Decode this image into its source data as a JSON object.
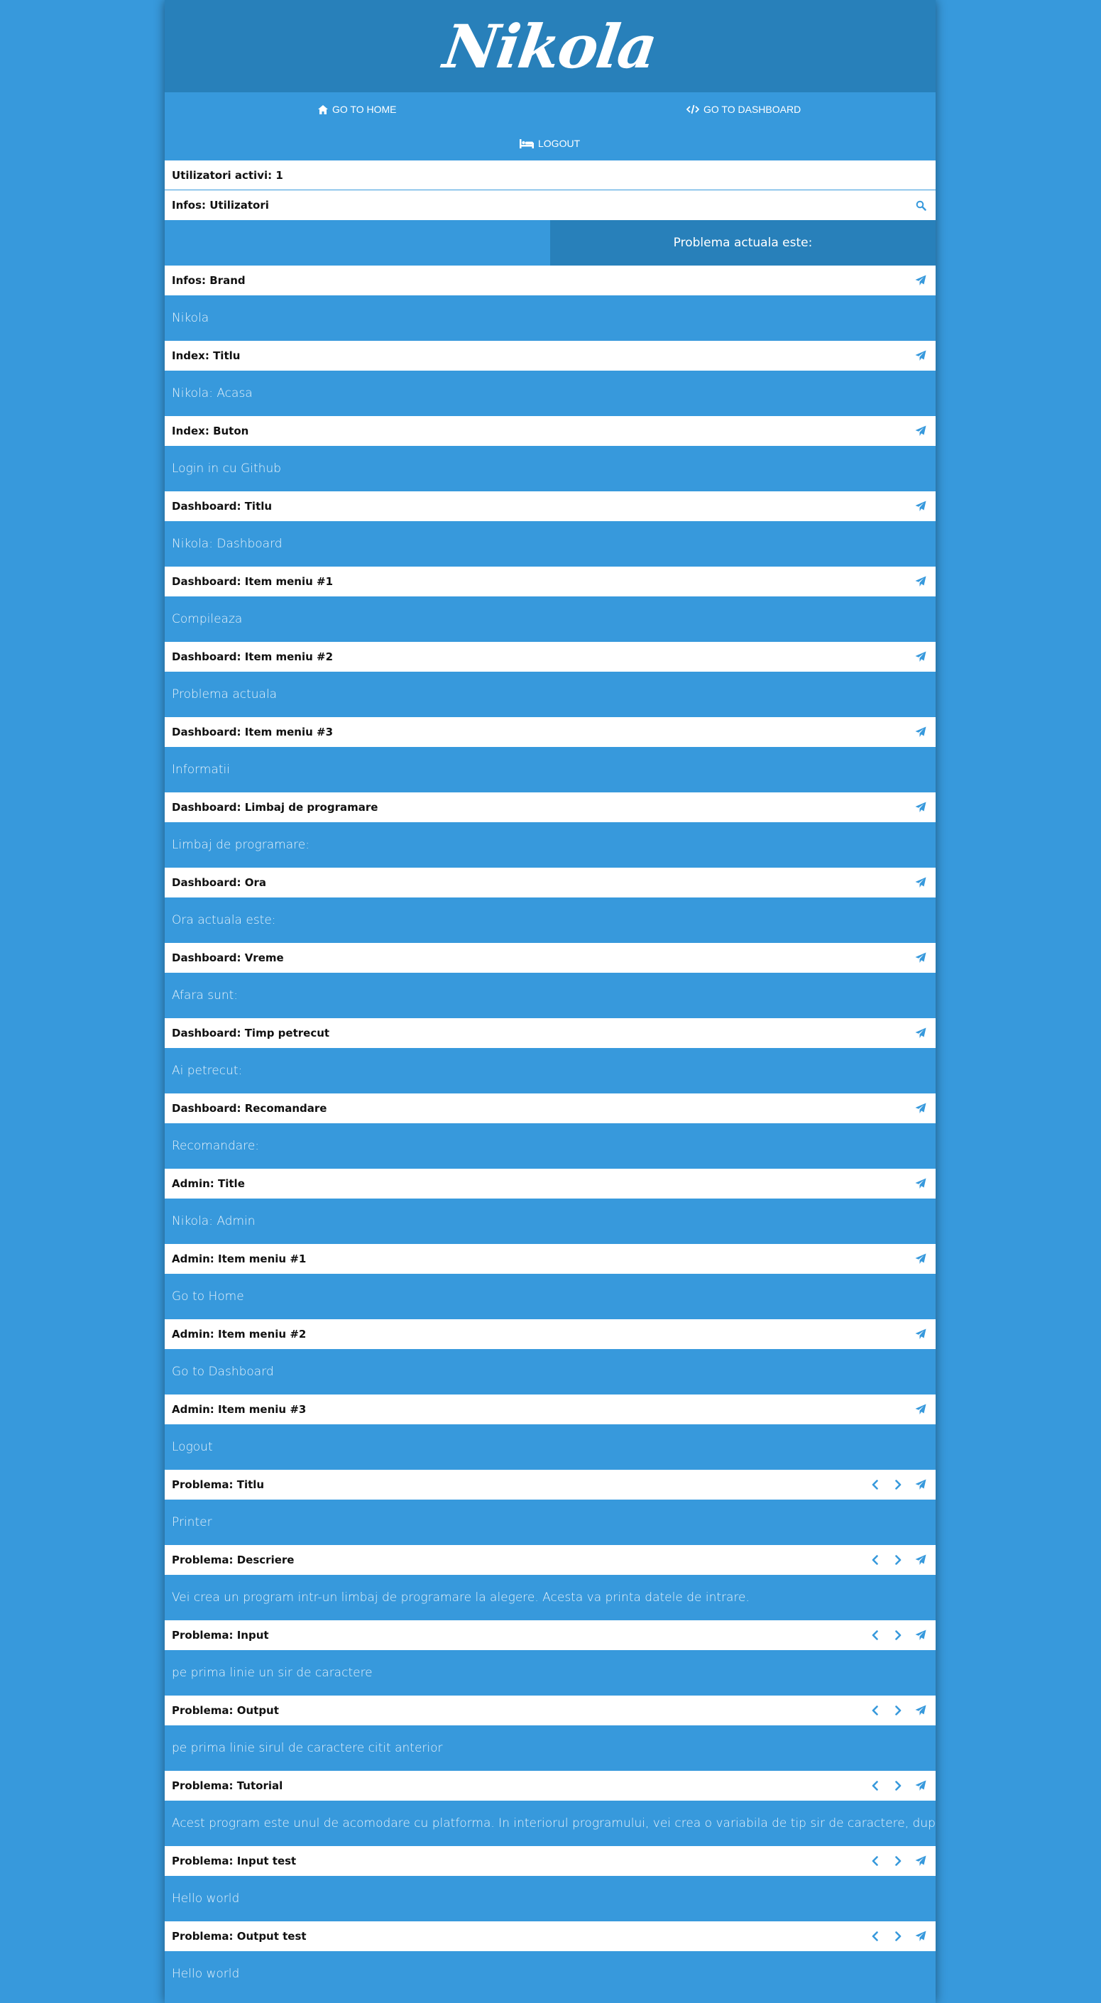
{
  "brand": "Nikola",
  "nav": {
    "home": "GO TO HOME",
    "dashboard": "GO TO DASHBOARD",
    "logout": "LOGOUT"
  },
  "active_users": "Utilizatori activi: 1",
  "users_section": "Infos: Utilizatori",
  "problem_header": "Problema actuala este:",
  "fields": [
    {
      "label": "Infos: Brand",
      "value": "Nikola"
    },
    {
      "label": "Index: Titlu",
      "value": "Nikola: Acasa"
    },
    {
      "label": "Index: Buton",
      "value": "Login in cu Github"
    },
    {
      "label": "Dashboard: Titlu",
      "value": "Nikola: Dashboard"
    },
    {
      "label": "Dashboard: Item meniu #1",
      "value": "Compileaza"
    },
    {
      "label": "Dashboard: Item meniu #2",
      "value": "Problema actuala"
    },
    {
      "label": "Dashboard: Item meniu #3",
      "value": "Informatii"
    },
    {
      "label": "Dashboard: Limbaj de programare",
      "value": "Limbaj de programare:"
    },
    {
      "label": "Dashboard: Ora",
      "value": "Ora actuala este:"
    },
    {
      "label": "Dashboard: Vreme",
      "value": "Afara sunt:"
    },
    {
      "label": "Dashboard: Timp petrecut",
      "value": "Ai petrecut:"
    },
    {
      "label": "Dashboard: Recomandare",
      "value": "Recomandare:"
    },
    {
      "label": "Admin: Title",
      "value": "Nikola: Admin"
    },
    {
      "label": "Admin: Item meniu #1",
      "value": "Go to Home"
    },
    {
      "label": "Admin: Item meniu #2",
      "value": "Go to Dashboard"
    },
    {
      "label": "Admin: Item meniu #3",
      "value": "Logout"
    }
  ],
  "problem_fields": [
    {
      "label": "Problema: Titlu",
      "value": "Printer"
    },
    {
      "label": "Problema: Descriere",
      "value": "Vei crea un program intr-un limbaj de programare la alegere. Acesta va printa datele de intrare."
    },
    {
      "label": "Problema: Input",
      "value": "pe prima linie un sir de caractere"
    },
    {
      "label": "Problema: Output",
      "value": "pe prima linie sirul de caractere citit anterior"
    },
    {
      "label": "Problema: Tutorial",
      "value": "Acest program este unul de acomodare cu platforma. In interiorul programului, vei crea o variabila de tip sir de caractere, dupa care"
    },
    {
      "label": "Problema: Input test",
      "value": "Hello world"
    },
    {
      "label": "Problema: Output test",
      "value": "Hello world"
    }
  ],
  "icons": {
    "home": "home-icon",
    "dashboard": "code-icon",
    "logout": "bed-icon",
    "search": "search-icon",
    "send": "paper-plane-icon",
    "prev": "chevron-left-icon",
    "next": "chevron-right-icon"
  },
  "colors": {
    "background": "#3799dc",
    "header": "#2880ba",
    "row": "#ffffff",
    "accent": "#3799dc"
  }
}
